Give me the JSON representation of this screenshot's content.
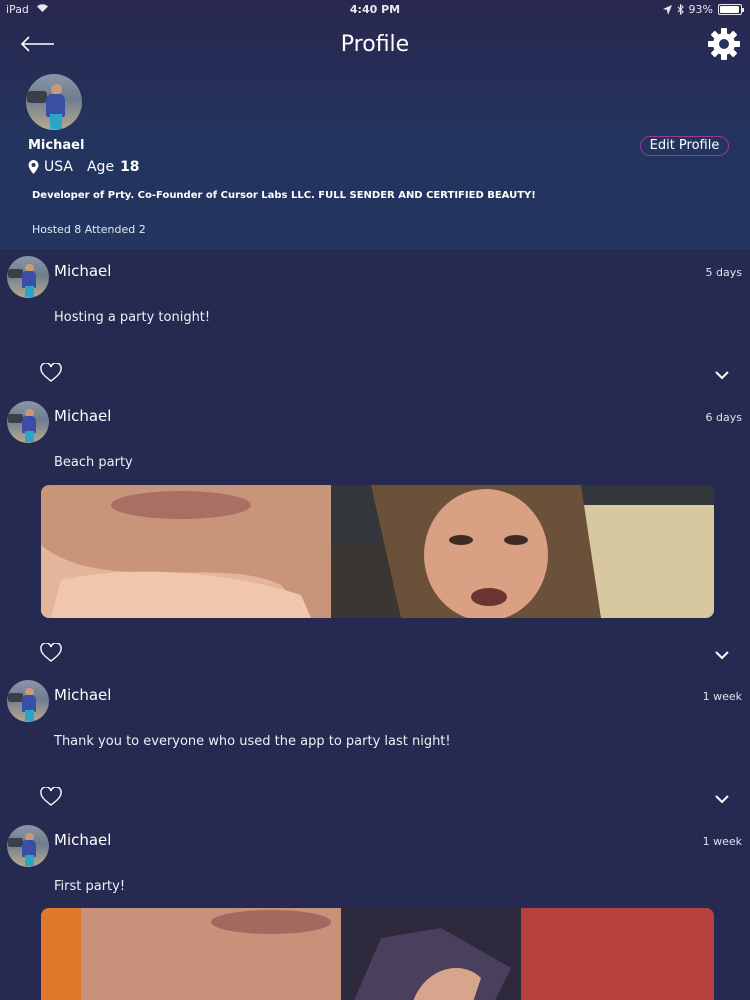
{
  "status_bar": {
    "carrier": "iPad",
    "time": "4:40 PM",
    "battery": "93%",
    "battery_level": 0.93
  },
  "nav": {
    "title": "Profile"
  },
  "profile": {
    "name": "Michael",
    "location": "USA",
    "age_label": "Age",
    "age": "18",
    "edit_label": "Edit Profile",
    "bio": "Developer of Prty. Co-Founder of Cursor Labs LLC. FULL SENDER AND CERTIFIED BEAUTY!",
    "stats": "Hosted 8 Attended 2"
  },
  "posts": [
    {
      "author": "Michael",
      "time": "5 days",
      "text": "Hosting a party tonight!"
    },
    {
      "author": "Michael",
      "time": "6 days",
      "text": "Beach party"
    },
    {
      "author": "Michael",
      "time": "1 week",
      "text": "Thank you to everyone who used the app to party last night!"
    },
    {
      "author": "Michael",
      "time": "1 week",
      "text": "First party!"
    }
  ],
  "colors": {
    "background": "#262a50",
    "header": "#23365f",
    "accent": "#9b3a8e"
  },
  "icons": [
    "back-arrow-icon",
    "gear-icon",
    "location-pin-icon",
    "heart-icon",
    "chevron-down-icon"
  ]
}
